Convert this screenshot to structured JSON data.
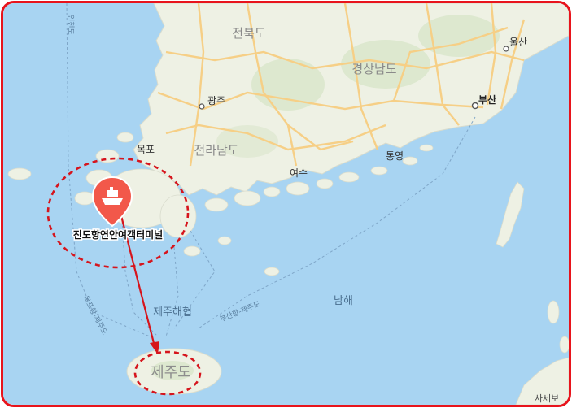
{
  "map": {
    "provinces": {
      "jeonbuk": "전북도",
      "gyeongnam": "경상남도",
      "jeonnam": "전라남도"
    },
    "cities": {
      "gwangju": "광주",
      "mokpo": "목포",
      "yeosu": "여수",
      "tongyeong": "통영",
      "busan": "부산",
      "ulsan": "울산"
    },
    "sea": {
      "south_sea": "남해",
      "jeju_strait": "제주해협"
    },
    "routes": {
      "busan_jeju": "부산항-제주도",
      "left_route_a": "인천도",
      "left_route_b": "목포항-제주도"
    },
    "terminal": {
      "label": "진도항연안여객터미널",
      "icon": "ferry-marker-icon"
    },
    "destination": {
      "label": "제주도"
    },
    "corner_label": "사세보",
    "colors": {
      "sea": "#a8d4f2",
      "land": "#eef1e4",
      "road": "#f6cf86",
      "highlight": "#d6141c",
      "marker": "#f2584a"
    }
  }
}
